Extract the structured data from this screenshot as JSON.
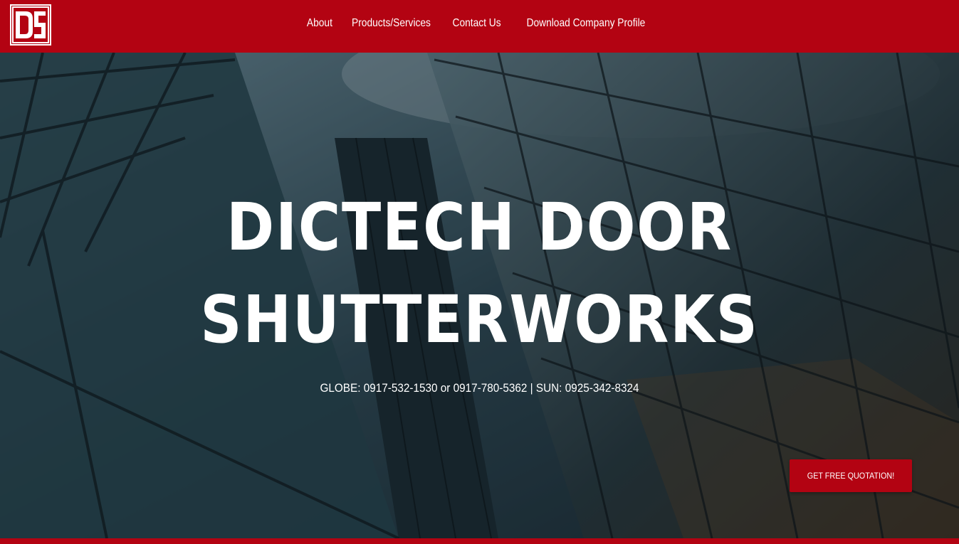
{
  "header": {
    "logo_text": "DS",
    "nav": [
      {
        "label": "About"
      },
      {
        "label": "Products/Services"
      },
      {
        "label": "Contact Us"
      },
      {
        "label": "Download Company Profile"
      }
    ]
  },
  "hero": {
    "title_line1": "DICTECH DOOR",
    "title_line2": "SHUTTERWORKS",
    "phones": "GLOBE: 0917-532-1530 or 0917-780-5362 | SUN: 0925-342-8324",
    "cta_label": "GET FREE QUOTATION!"
  },
  "colors": {
    "brand_red": "#b30312",
    "text_white": "#ffffff"
  }
}
